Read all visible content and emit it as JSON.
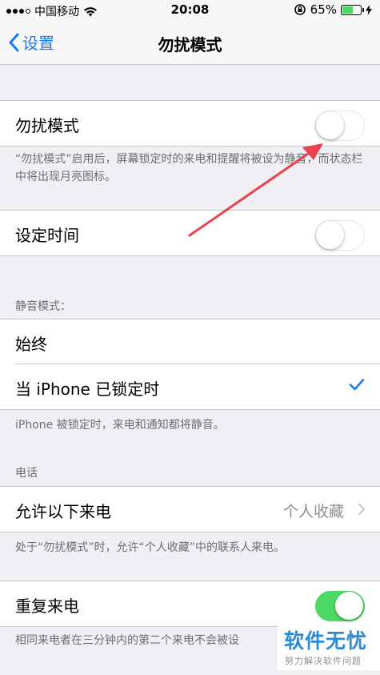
{
  "status_bar": {
    "carrier": "中国移动",
    "time": "20:08",
    "battery_percent": "65%",
    "battery_level": 0.65
  },
  "nav": {
    "back_label": "设置",
    "title": "勿扰模式"
  },
  "dnd": {
    "label": "勿扰模式",
    "enabled": false,
    "footnote": "“勿扰模式”启用后，屏幕锁定时的来电和提醒将被设为静音，而状态栏中将出现月亮图标。"
  },
  "scheduled": {
    "label": "设定时间",
    "enabled": false
  },
  "silence": {
    "header": "静音模式：",
    "options": [
      {
        "label": "始终"
      },
      {
        "label": "当 iPhone 已锁定时"
      }
    ],
    "footnote": "iPhone 被锁定时，来电和通知都将静音。"
  },
  "phone": {
    "header": "电话",
    "allow_calls_label": "允许以下来电",
    "allow_calls_value": "个人收藏",
    "allow_calls_footnote": "处于“勿扰模式”时，允许“个人收藏”中的联系人来电。",
    "repeated_calls_label": "重复来电",
    "repeated_calls_enabled": true,
    "repeated_calls_footnote": "相同来电者在三分钟内的第二个来电不会被设"
  },
  "watermark": {
    "main": "软件无忧",
    "sub": "努力解决软件问题"
  },
  "colors": {
    "accent": "#1a7cf4",
    "toggle_on": "#4cd964",
    "annotation_arrow": "#e8434f"
  }
}
